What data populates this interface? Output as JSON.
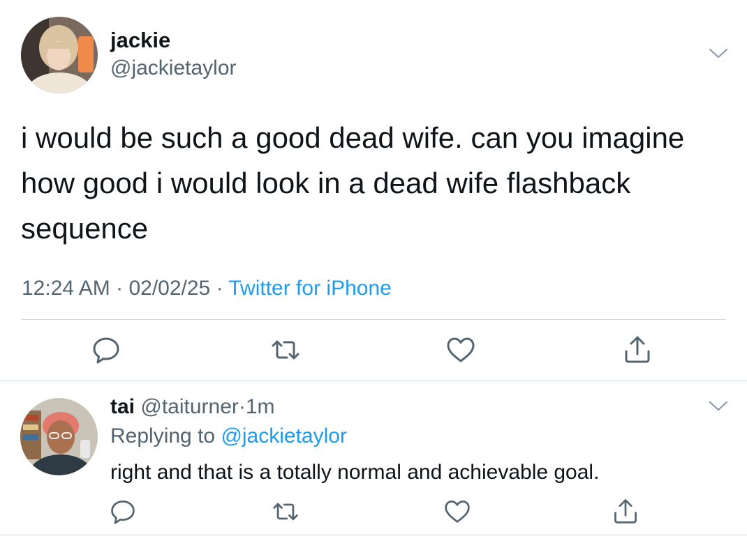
{
  "main_tweet": {
    "display_name": "jackie",
    "handle": "@jackietaylor",
    "avatar_icon": "profile-photo-icon",
    "text_lines": [
      "i would be such a good dead wife. can you imagine",
      "how good i would look in a dead wife flashback",
      "sequence"
    ],
    "time": "12:24 AM",
    "date": "02/02/25",
    "source": "Twitter for iPhone",
    "separator": "·"
  },
  "reply_tweet": {
    "display_name": "tai",
    "handle": "@taiturner",
    "separator": "·",
    "time_ago": "1m",
    "replying_prefix": "Replying to",
    "replying_to": "@jackietaylor",
    "text": "right and that is a totally normal and achievable goal.",
    "avatar_icon": "profile-photo-icon"
  },
  "actions": [
    "reply-icon",
    "retweet-icon",
    "like-icon",
    "share-icon"
  ],
  "colors": {
    "text": "#0f1419",
    "secondary": "#536471",
    "link": "#1d9bf0",
    "divider": "#cfd9de"
  }
}
